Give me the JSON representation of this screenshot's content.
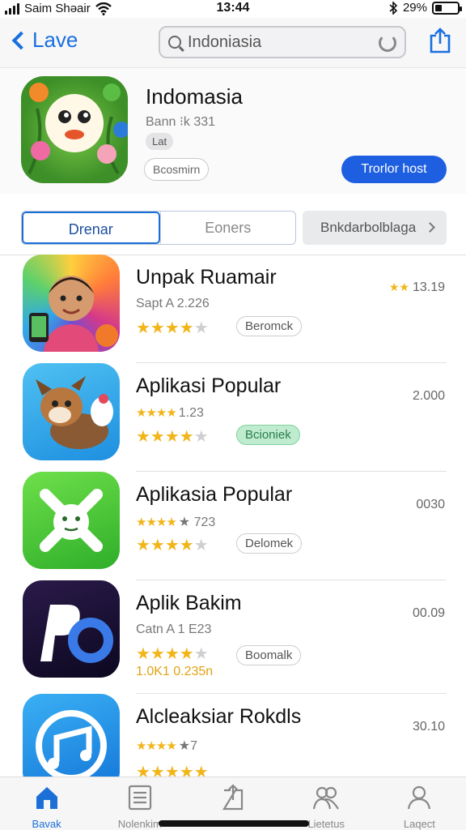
{
  "status_bar": {
    "carrier": "Saim Shəair",
    "time": "13:44",
    "battery_percent": "29%",
    "battery_level": 0.29
  },
  "nav": {
    "back_label": "Lave",
    "search_value": "Indoniasia"
  },
  "app": {
    "title": "Indomasia",
    "subtitle": "Bann ⁝k 331",
    "chip": "Lat",
    "outline_button": "Bcosmirn",
    "primary_button": "Trorlor host"
  },
  "segments": {
    "items": [
      "Drenar",
      "Eoners"
    ],
    "active": 0
  },
  "category_button": "Bnkdarbolblaga",
  "rows": [
    {
      "title": "Unpak Ruamair",
      "meta": "Sapt A 2.226",
      "rating": 4,
      "button": "Beromck",
      "value": "13.19",
      "value_prefix": "★★"
    },
    {
      "title": "Aplikasi Popular",
      "meta_stars": "★★★★",
      "meta": "1.23",
      "rating": 4,
      "button": "Bcioniek",
      "value": "2.000"
    },
    {
      "title": "Aplikasia Popular",
      "meta_stars": "★★★★",
      "meta": "★ 723",
      "rating": 4,
      "button": "Delomek",
      "value": "0030"
    },
    {
      "title": "Aplik Bakim",
      "meta": "Catn A 1 E23",
      "rating": 4,
      "button": "Boomalk",
      "value": "00.09",
      "extra": "1.0K1 0.235n"
    },
    {
      "title": "Alcleaksiar Rokdls",
      "meta_stars": "★★★★",
      "meta": "★7",
      "rating": 5,
      "value": "30.10"
    }
  ],
  "tabs": [
    {
      "label": "Bavak",
      "icon": "home-icon"
    },
    {
      "label": "Nolenkim",
      "icon": "list-icon"
    },
    {
      "label": "",
      "icon": "upload-icon"
    },
    {
      "label": "Lietetus",
      "icon": "people-icon"
    },
    {
      "label": "Laqect",
      "icon": "profile-icon"
    }
  ],
  "colors": {
    "accent": "#1d5fe0",
    "star": "#f2b519",
    "green_button": "#bfeccf"
  }
}
